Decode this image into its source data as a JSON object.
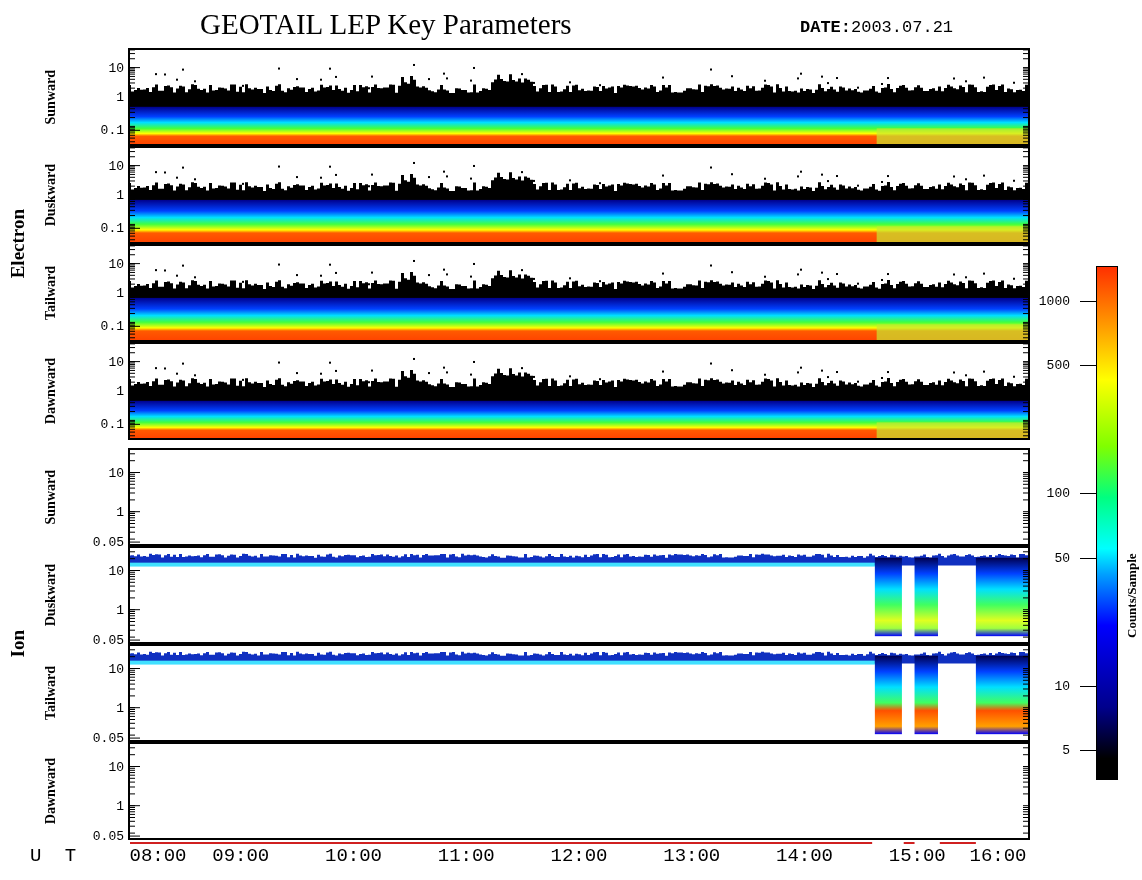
{
  "title": "GEOTAIL LEP Key Parameters",
  "date": "**DATE:**2003.07.21",
  "groups": [
    {
      "species": "Electron",
      "panels": [
        {
          "direction": "Sunward",
          "kind": "electron",
          "yticks": [
            "10",
            "1",
            "0.1"
          ]
        },
        {
          "direction": "Duskward",
          "kind": "electron-hot",
          "yticks": [
            "10",
            "1",
            "0.1"
          ]
        },
        {
          "direction": "Tailward",
          "kind": "electron-hot",
          "yticks": [
            "10",
            "1",
            "0.1"
          ]
        },
        {
          "direction": "Dawnward",
          "kind": "electron",
          "yticks": [
            "10",
            "1",
            "0.1"
          ]
        }
      ]
    },
    {
      "species": "Ion",
      "panels": [
        {
          "direction": "Sunward",
          "kind": "empty",
          "yticks": [
            "10",
            "1",
            "0.05"
          ]
        },
        {
          "direction": "Duskward",
          "kind": "ion",
          "yticks": [
            "10",
            "1",
            "0.05"
          ]
        },
        {
          "direction": "Tailward",
          "kind": "ion-hot",
          "yticks": [
            "10",
            "1",
            "0.05"
          ]
        },
        {
          "direction": "Dawnward",
          "kind": "empty",
          "yticks": [
            "10",
            "1",
            "0.05"
          ]
        }
      ]
    }
  ],
  "x_axis": {
    "label": "U T",
    "ticks": [
      "08:00",
      "09:00",
      "10:00",
      "11:00",
      "12:00",
      "13:00",
      "14:00",
      "15:00",
      "16:00"
    ]
  },
  "colorbar": {
    "label": "Counts/Sample",
    "ticks": [
      "1000",
      "500",
      "100",
      "50",
      "10",
      "5"
    ]
  }
}
